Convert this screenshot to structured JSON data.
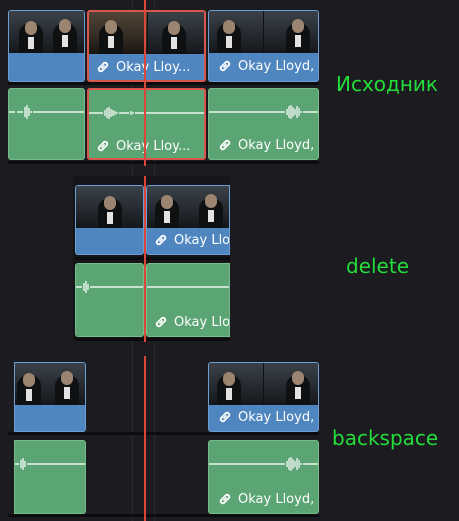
{
  "section_labels": {
    "original": "Исходник",
    "delete": "delete",
    "backspace": "backspace"
  },
  "clip_name_long": "Okay Lloyd,",
  "clip_name_short": "Okay Lloy...",
  "clip_name_cut": "Okay Llo",
  "colors": {
    "video_clip": "#4f86c0",
    "audio_clip": "#5ba473",
    "selection_border": "#d9564a",
    "playhead": "#d9463a",
    "label_text": "#22dd3a",
    "background": "#1c1c20"
  },
  "icons": {
    "link": "link-icon"
  }
}
